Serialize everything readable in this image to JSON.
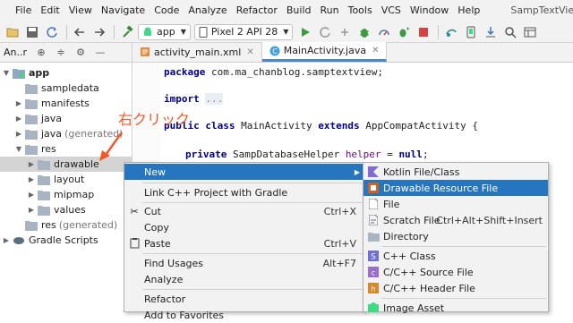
{
  "menubar": {
    "items": [
      "File",
      "Edit",
      "View",
      "Navigate",
      "Code",
      "Analyze",
      "Refactor",
      "Build",
      "Run",
      "Tools",
      "VCS",
      "Window",
      "Help"
    ],
    "title": "SampTextView"
  },
  "toolbar": {
    "module": "app",
    "device": "Pixel 2 API 28"
  },
  "project_pane": {
    "title": "An..r"
  },
  "editor_tabs": [
    {
      "label": "activity_main.xml",
      "active": false
    },
    {
      "label": "MainActivity.java",
      "active": true
    }
  ],
  "tree": [
    {
      "label": "app",
      "gen": ""
    },
    {
      "label": "sampledata",
      "gen": ""
    },
    {
      "label": "manifests",
      "gen": ""
    },
    {
      "label": "java",
      "gen": ""
    },
    {
      "label": "java",
      "gen": "(generated)"
    },
    {
      "label": "res",
      "gen": ""
    },
    {
      "label": "drawable",
      "gen": ""
    },
    {
      "label": "layout",
      "gen": ""
    },
    {
      "label": "mipmap",
      "gen": ""
    },
    {
      "label": "values",
      "gen": ""
    },
    {
      "label": "res",
      "gen": "(generated)"
    },
    {
      "label": "Gradle Scripts",
      "gen": ""
    }
  ],
  "code": {
    "line1_kw": "package",
    "line1_rest": " com.ma_chanblog.samptextview;",
    "line2_kw": "import",
    "line2_fold": "...",
    "line3_kw1": "public",
    "line3_kw2": "class",
    "line3_name": " MainActivity ",
    "line3_kw3": "extends",
    "line3_rest": " AppCompatActivity {",
    "line4_kw": "private",
    "line4_type": " SampDatabaseHelper ",
    "line4_field": "helper",
    "line4_eq": " = ",
    "line4_kw2": "null",
    "line4_end": ";"
  },
  "annotation": "右クリック",
  "context_menu": {
    "items": [
      {
        "label": "New",
        "shortcut": "",
        "submenu": true,
        "icon": "",
        "highlight": true
      },
      {
        "label": "Link C++ Project with Gradle",
        "shortcut": "",
        "icon": ""
      },
      {
        "label": "Cut",
        "shortcut": "Ctrl+X",
        "icon": "scissors-icon"
      },
      {
        "label": "Copy",
        "shortcut": "",
        "submenu": true,
        "icon": ""
      },
      {
        "label": "Paste",
        "shortcut": "Ctrl+V",
        "icon": "clipboard-icon"
      },
      {
        "label": "Find Usages",
        "shortcut": "Alt+F7",
        "icon": ""
      },
      {
        "label": "Analyze",
        "shortcut": "",
        "submenu": true,
        "icon": ""
      },
      {
        "label": "Refactor",
        "shortcut": "",
        "submenu": true,
        "icon": ""
      },
      {
        "label": "Add to Favorites",
        "shortcut": "",
        "submenu": true,
        "icon": ""
      }
    ]
  },
  "sub_menu": {
    "items": [
      {
        "label": "Kotlin File/Class",
        "shortcut": "",
        "icon": "kotlin-file-icon"
      },
      {
        "label": "Drawable Resource File",
        "shortcut": "",
        "icon": "drawable-resource-icon",
        "highlight": true
      },
      {
        "label": "File",
        "shortcut": "",
        "icon": "file-icon"
      },
      {
        "label": "Scratch File",
        "shortcut": "Ctrl+Alt+Shift+Insert",
        "icon": "scratch-file-icon"
      },
      {
        "label": "Directory",
        "shortcut": "",
        "icon": "folder-icon"
      },
      {
        "label": "C++ Class",
        "shortcut": "",
        "icon": "cpp-class-icon"
      },
      {
        "label": "C/C++ Source File",
        "shortcut": "",
        "icon": "cpp-source-icon"
      },
      {
        "label": "C/C++ Header File",
        "shortcut": "",
        "icon": "cpp-header-icon"
      },
      {
        "label": "Image Asset",
        "shortcut": "",
        "icon": "image-asset-icon"
      }
    ]
  },
  "colors": {
    "accent": "#2675bf",
    "annotation": "#f05a28",
    "keyword": "#000080",
    "field": "#660e7a"
  }
}
